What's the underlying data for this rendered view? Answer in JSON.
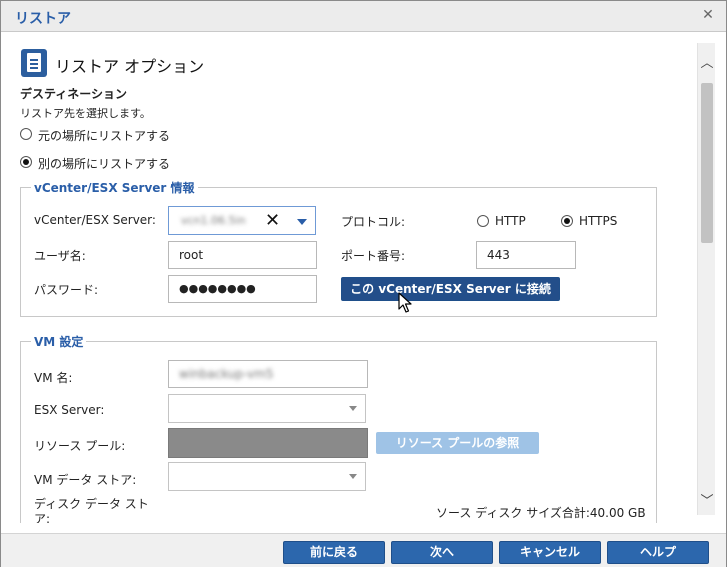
{
  "dialog": {
    "title": "リストア",
    "close_glyph": "✕"
  },
  "header": {
    "title": "リストア オプション"
  },
  "destination": {
    "heading": "デスティネーション",
    "instruction": "リストア先を選択します。",
    "options": [
      {
        "label": "元の場所にリストアする",
        "selected": false
      },
      {
        "label": "別の場所にリストアする",
        "selected": true
      }
    ]
  },
  "vcenter": {
    "legend": "vCenter/ESX Server 情報",
    "server_label": "vCenter/ESX Server:",
    "server_value": "vcn1.06.5in",
    "username_label": "ユーザ名:",
    "username_value": "root",
    "password_label": "パスワード:",
    "password_value": "●●●●●●●●",
    "protocol_label": "プロトコル:",
    "protocol_options": [
      {
        "label": "HTTP",
        "selected": false
      },
      {
        "label": "HTTPS",
        "selected": true
      }
    ],
    "port_label": "ポート番号:",
    "port_value": "443",
    "connect_button": "この vCenter/ESX Server に接続"
  },
  "vm_settings": {
    "legend": "VM 設定",
    "vm_name_label": "VM 名:",
    "vm_name_value": "winbackup-vm5",
    "esx_server_label": "ESX Server:",
    "resource_pool_label": "リソース プール:",
    "resource_pool_button": "リソース プールの参照",
    "datastore_label": "VM データ ストア:",
    "disk_datastore_label": "ディスク データ ストア:",
    "disk_total_label": "ソース ディスク サイズ合計:40.00 GB"
  },
  "footer": {
    "back": "前に戻る",
    "next": "次へ",
    "cancel": "キャンセル",
    "help": "ヘルプ"
  },
  "colors": {
    "accent": "#2a5ea8",
    "button": "#2c67ad",
    "button_disabled": "#9fc3e6"
  }
}
